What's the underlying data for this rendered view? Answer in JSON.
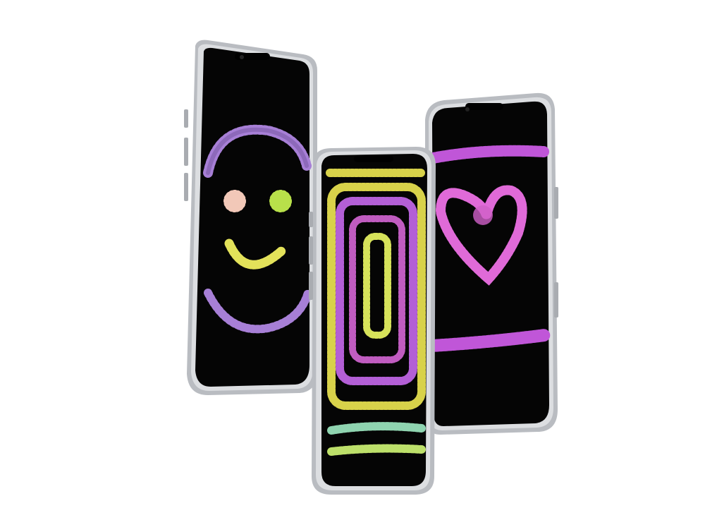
{
  "scene": {
    "background": "#ffffff",
    "frame_color": "#c9cbcf",
    "screen_color": "#050505"
  },
  "phones": [
    {
      "id": "left",
      "drawing": "smiley-face",
      "colors": {
        "outline": "#a77fd6",
        "left_eye": "#f2c8b8",
        "right_eye": "#b8e04a",
        "mouth": "#e3e25a"
      }
    },
    {
      "id": "center",
      "drawing": "nested-rounded-rectangles",
      "colors": {
        "outer": "#d8d24a",
        "ring": "#b35fd6",
        "inner": "#c05cc0",
        "core": "#d6e25a",
        "bar_top": "#8fd4b0",
        "bar_bottom": "#bde06a"
      }
    },
    {
      "id": "right",
      "drawing": "heart-with-bands",
      "colors": {
        "bands": "#c056d8",
        "heart": "#e06ad8"
      }
    }
  ]
}
